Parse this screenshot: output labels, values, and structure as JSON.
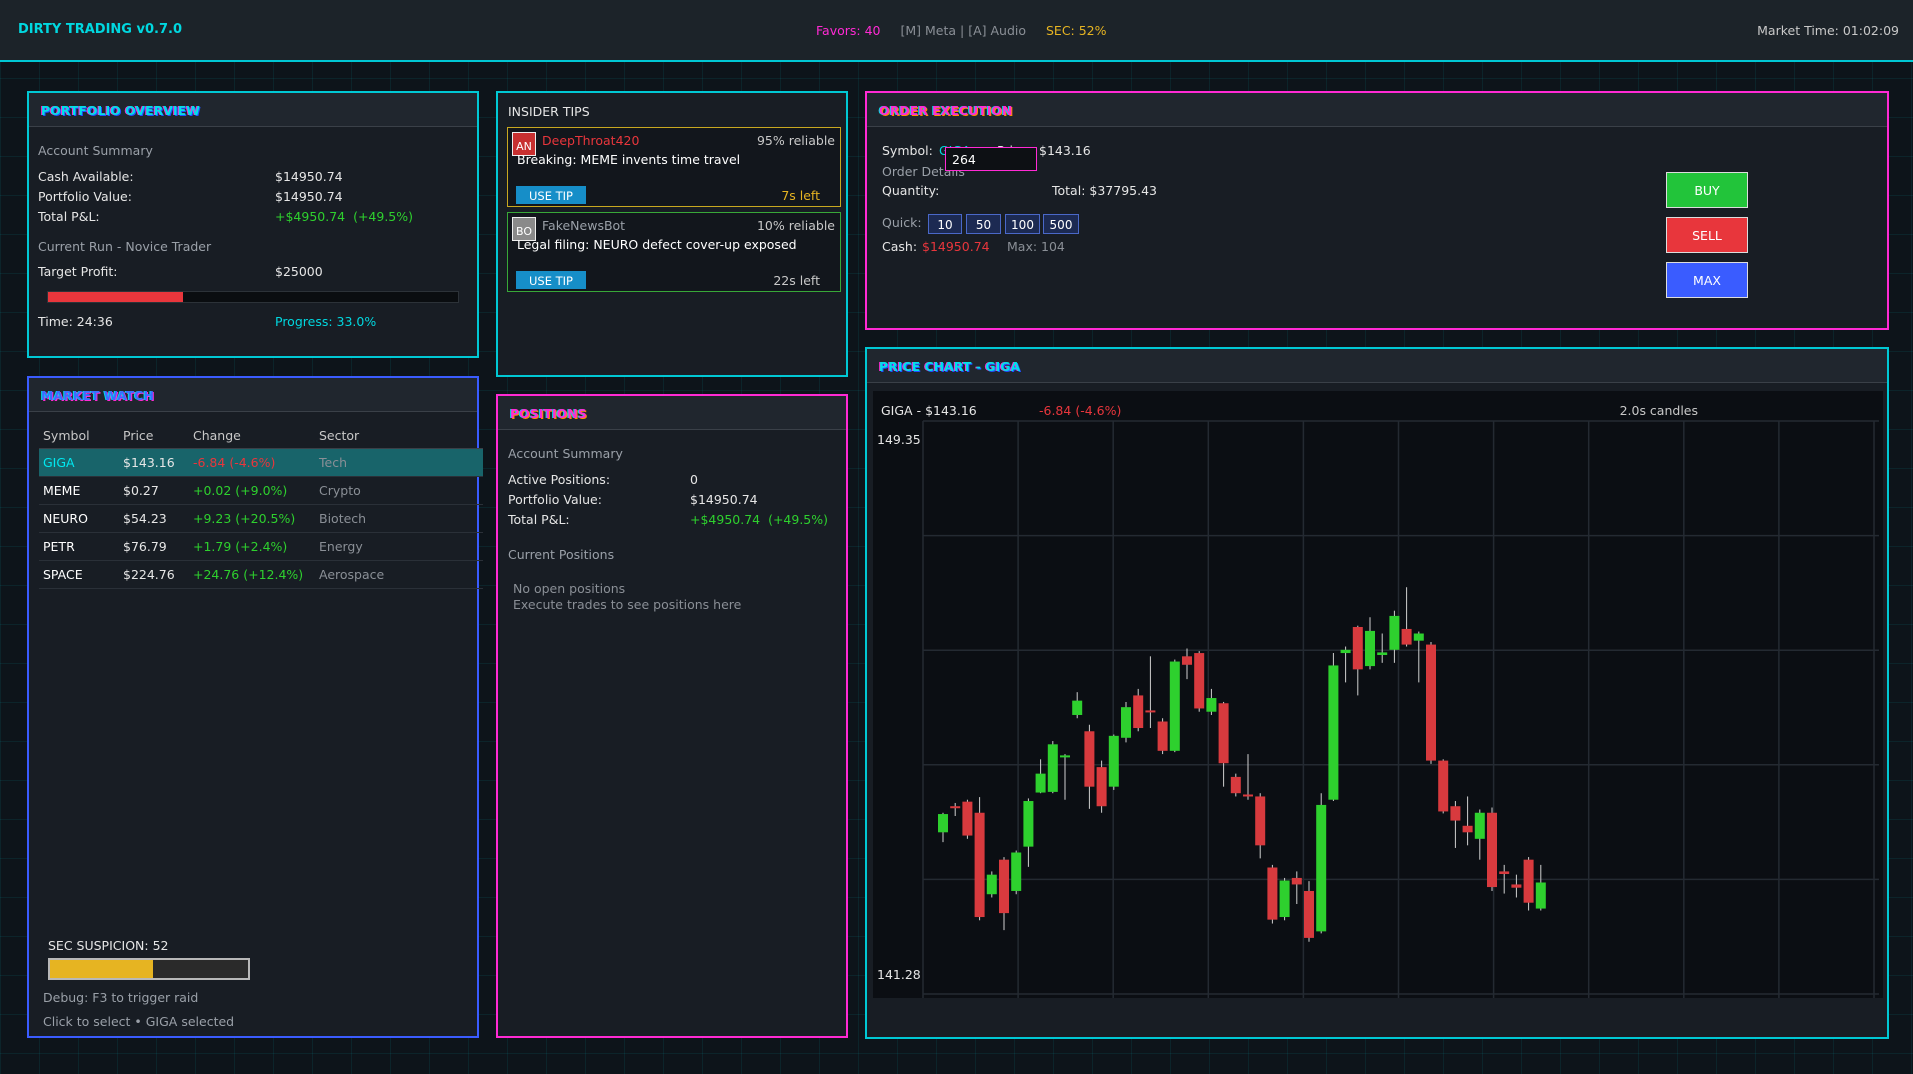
{
  "topbar": {
    "title": "DIRTY TRADING v0.7.0",
    "favors": "Favors: 40",
    "shortcuts": "[M] Meta | [A] Audio",
    "sec": "SEC: 52%",
    "market_time": "Market Time: 01:02:09"
  },
  "portfolio": {
    "title": "PORTFOLIO OVERVIEW",
    "account_summary": "Account Summary",
    "cash_label": "Cash Available:",
    "cash_value": "$14950.74",
    "portfolio_label": "Portfolio Value:",
    "portfolio_value": "$14950.74",
    "pnl_label": "Total P&L:",
    "pnl_value": "+$4950.74",
    "pnl_pct": "(+49.5%)",
    "run_label": "Current Run - Novice Trader",
    "target_label": "Target Profit:",
    "target_value": "$25000",
    "progress_fraction": 0.33,
    "time_label": "Time: 24:36",
    "progress_label": "Progress: 33.0%"
  },
  "market_watch": {
    "title": "MARKET WATCH",
    "columns": [
      "Symbol",
      "Price",
      "Change",
      "Sector"
    ],
    "rows": [
      {
        "symbol": "GIGA",
        "price": "$143.16",
        "change": "-6.84",
        "pct": "(-4.6%)",
        "sector": "Tech",
        "dir": "down",
        "selected": true
      },
      {
        "symbol": "MEME",
        "price": "$0.27",
        "change": "+0.02",
        "pct": "(+9.0%)",
        "sector": "Crypto",
        "dir": "up",
        "selected": false
      },
      {
        "symbol": "NEURO",
        "price": "$54.23",
        "change": "+9.23",
        "pct": "(+20.5%)",
        "sector": "Biotech",
        "dir": "up",
        "selected": false
      },
      {
        "symbol": "PETR",
        "price": "$76.79",
        "change": "+1.79",
        "pct": "(+2.4%)",
        "sector": "Energy",
        "dir": "up",
        "selected": false
      },
      {
        "symbol": "SPACE",
        "price": "$224.76",
        "change": "+24.76",
        "pct": "(+12.4%)",
        "sector": "Aerospace",
        "dir": "up",
        "selected": false
      }
    ],
    "sec_label": "SEC SUSPICION: 52",
    "sec_fraction": 0.52,
    "debug": "Debug: F3 to trigger raid",
    "footer": "Click to select • GIGA selected"
  },
  "insider": {
    "title": "INSIDER TIPS",
    "tips": [
      {
        "avatar": "AN",
        "source": "DeepThroat420",
        "reliability": "95% reliable",
        "text": "Breaking: MEME invents time travel",
        "button": "USE TIP",
        "time": "7s left",
        "border": "#c8a820",
        "avatar_bg": "#c83030",
        "source_color": "#e8363c",
        "time_color": "#e6b422"
      },
      {
        "avatar": "BO",
        "source": "FakeNewsBot",
        "reliability": "10% reliable",
        "text": "Legal filing: NEURO defect cover-up exposed",
        "button": "USE TIP",
        "time": "22s left",
        "border": "#38a838",
        "avatar_bg": "#8a8a8a",
        "source_color": "#9aa0a8",
        "time_color": "#c8c8c8"
      }
    ]
  },
  "positions": {
    "title": "POSITIONS",
    "account_summary": "Account Summary",
    "active_label": "Active Positions:",
    "active_value": "0",
    "portfolio_label": "Portfolio Value:",
    "portfolio_value": "$14950.74",
    "pnl_label": "Total P&L:",
    "pnl_value": "+$4950.74",
    "pnl_pct": "(+49.5%)",
    "current_label": "Current Positions",
    "empty1": "No open positions",
    "empty2": "Execute trades to see positions here"
  },
  "order": {
    "title": "ORDER EXECUTION",
    "symbol_label": "Symbol:",
    "symbol_value": "GIGA",
    "price_label": "Price:",
    "price_value": "$143.16",
    "details_label": "Order Details",
    "quantity_label": "Quantity:",
    "quantity_value": "264",
    "total": "Total: $37795.43",
    "quick_label": "Quick:",
    "quick": [
      "10",
      "50",
      "100",
      "500"
    ],
    "cash_label": "Cash:",
    "cash_value": "$14950.74",
    "max_label": "Max: 104",
    "buy": "BUY",
    "sell": "SELL",
    "max_btn": "MAX"
  },
  "chart_header": {
    "title": "PRICE CHART - GIGA",
    "label": "GIGA - $143.16",
    "change": "-6.84 (-4.6%)",
    "interval": "2.0s candles"
  },
  "colors": {
    "up": "#2ed02e",
    "down": "#d83a3e",
    "cyan": "#00d8e0",
    "magenta": "#ff2ad4",
    "blue": "#3a5cff"
  },
  "chart_data": {
    "type": "candlestick",
    "ylim": [
      141.28,
      149.35
    ],
    "ytick_labels": [
      "149.35",
      "141.28"
    ],
    "candles": [
      {
        "o": 143.5,
        "c": 143.78,
        "h": 143.8,
        "l": 143.35
      },
      {
        "o": 143.9,
        "c": 143.88,
        "h": 143.95,
        "l": 143.75
      },
      {
        "o": 143.97,
        "c": 143.45,
        "h": 144.0,
        "l": 143.4
      },
      {
        "o": 143.8,
        "c": 142.2,
        "h": 144.04,
        "l": 142.15
      },
      {
        "o": 142.55,
        "c": 142.85,
        "h": 142.9,
        "l": 142.5
      },
      {
        "o": 143.08,
        "c": 142.26,
        "h": 143.12,
        "l": 142.0
      },
      {
        "o": 142.6,
        "c": 143.19,
        "h": 143.22,
        "l": 142.55
      },
      {
        "o": 143.28,
        "c": 143.98,
        "h": 144.02,
        "l": 142.97
      },
      {
        "o": 144.11,
        "c": 144.4,
        "h": 144.62,
        "l": 144.1
      },
      {
        "o": 144.12,
        "c": 144.85,
        "h": 144.9,
        "l": 144.1
      },
      {
        "o": 144.65,
        "c": 144.68,
        "h": 144.7,
        "l": 144.0
      },
      {
        "o": 145.3,
        "c": 145.52,
        "h": 145.65,
        "l": 145.25
      },
      {
        "o": 145.05,
        "c": 144.2,
        "h": 145.15,
        "l": 143.86
      },
      {
        "o": 144.5,
        "c": 143.9,
        "h": 144.6,
        "l": 143.8
      },
      {
        "o": 144.2,
        "c": 144.98,
        "h": 145.0,
        "l": 144.15
      },
      {
        "o": 144.95,
        "c": 145.42,
        "h": 145.5,
        "l": 144.88
      },
      {
        "o": 145.6,
        "c": 145.1,
        "h": 145.7,
        "l": 145.05
      },
      {
        "o": 145.37,
        "c": 145.34,
        "h": 146.2,
        "l": 145.1
      },
      {
        "o": 145.2,
        "c": 144.75,
        "h": 145.25,
        "l": 144.7
      },
      {
        "o": 144.75,
        "c": 146.12,
        "h": 146.15,
        "l": 144.73
      },
      {
        "o": 146.2,
        "c": 146.07,
        "h": 146.32,
        "l": 145.85
      },
      {
        "o": 146.25,
        "c": 145.4,
        "h": 146.28,
        "l": 145.35
      },
      {
        "o": 145.35,
        "c": 145.56,
        "h": 145.7,
        "l": 145.3
      },
      {
        "o": 145.48,
        "c": 144.56,
        "h": 145.5,
        "l": 144.2
      },
      {
        "o": 144.35,
        "c": 144.1,
        "h": 144.4,
        "l": 144.05
      },
      {
        "o": 144.08,
        "c": 144.05,
        "h": 144.7,
        "l": 144.0
      },
      {
        "o": 144.05,
        "c": 143.3,
        "h": 144.1,
        "l": 143.1
      },
      {
        "o": 142.96,
        "c": 142.16,
        "h": 143.0,
        "l": 142.1
      },
      {
        "o": 142.2,
        "c": 142.76,
        "h": 142.8,
        "l": 142.15
      },
      {
        "o": 142.8,
        "c": 142.7,
        "h": 142.9,
        "l": 142.4
      },
      {
        "o": 142.6,
        "c": 141.88,
        "h": 142.75,
        "l": 141.82
      },
      {
        "o": 141.98,
        "c": 143.92,
        "h": 144.1,
        "l": 141.95
      },
      {
        "o": 144.0,
        "c": 146.06,
        "h": 146.25,
        "l": 143.98
      },
      {
        "o": 146.25,
        "c": 146.3,
        "h": 146.35,
        "l": 145.8
      },
      {
        "o": 146.65,
        "c": 146.0,
        "h": 146.67,
        "l": 145.6
      },
      {
        "o": 146.05,
        "c": 146.59,
        "h": 146.8,
        "l": 146.0
      },
      {
        "o": 146.22,
        "c": 146.26,
        "h": 146.55,
        "l": 146.1
      },
      {
        "o": 146.3,
        "c": 146.82,
        "h": 146.9,
        "l": 146.1
      },
      {
        "o": 146.62,
        "c": 146.38,
        "h": 147.26,
        "l": 146.35
      },
      {
        "o": 146.44,
        "c": 146.55,
        "h": 146.58,
        "l": 145.8
      },
      {
        "o": 146.38,
        "c": 144.6,
        "h": 146.42,
        "l": 144.55
      },
      {
        "o": 144.6,
        "c": 143.82,
        "h": 144.62,
        "l": 143.79
      },
      {
        "o": 143.9,
        "c": 143.68,
        "h": 143.98,
        "l": 143.26
      },
      {
        "o": 143.6,
        "c": 143.5,
        "h": 144.05,
        "l": 143.3
      },
      {
        "o": 143.4,
        "c": 143.8,
        "h": 143.85,
        "l": 143.08
      },
      {
        "o": 143.8,
        "c": 142.66,
        "h": 143.88,
        "l": 142.6
      },
      {
        "o": 142.9,
        "c": 142.86,
        "h": 143.0,
        "l": 142.56
      },
      {
        "o": 142.7,
        "c": 142.65,
        "h": 142.85,
        "l": 142.5
      },
      {
        "o": 143.08,
        "c": 142.42,
        "h": 143.12,
        "l": 142.3
      },
      {
        "o": 142.33,
        "c": 142.73,
        "h": 143.0,
        "l": 142.3
      }
    ]
  }
}
